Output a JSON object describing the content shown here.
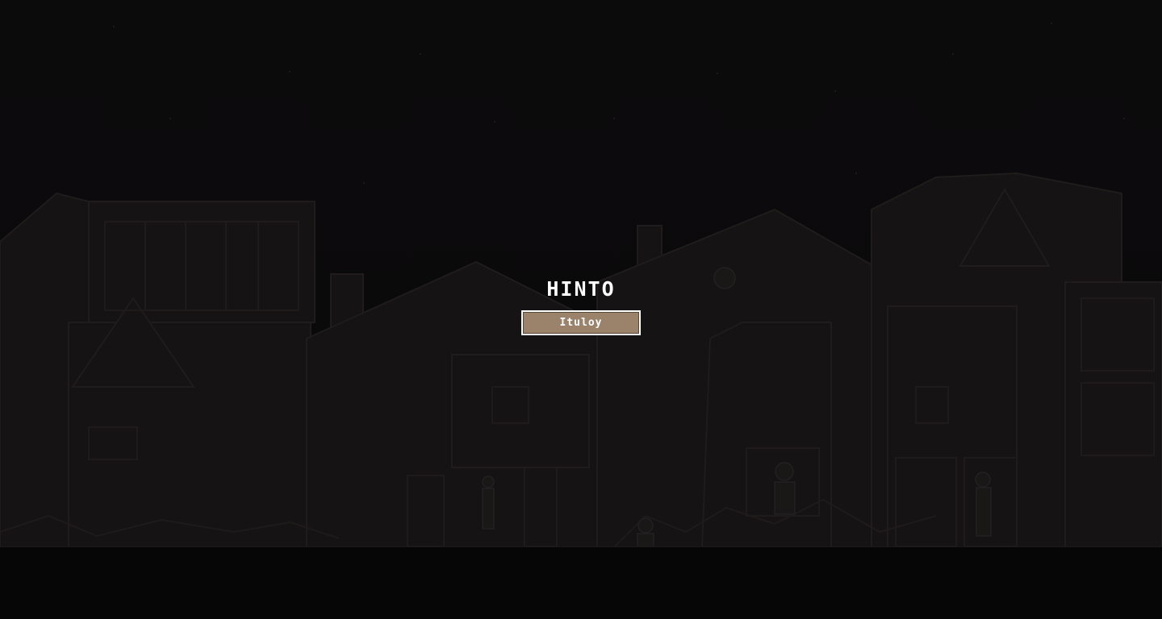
{
  "pause_menu": {
    "title": "HINTO",
    "resume_label": "Ituloy"
  },
  "colors": {
    "background": "#0b0a0b",
    "button_fill": "#9a826b",
    "button_border": "#ffffff",
    "text": "#ffffff"
  }
}
